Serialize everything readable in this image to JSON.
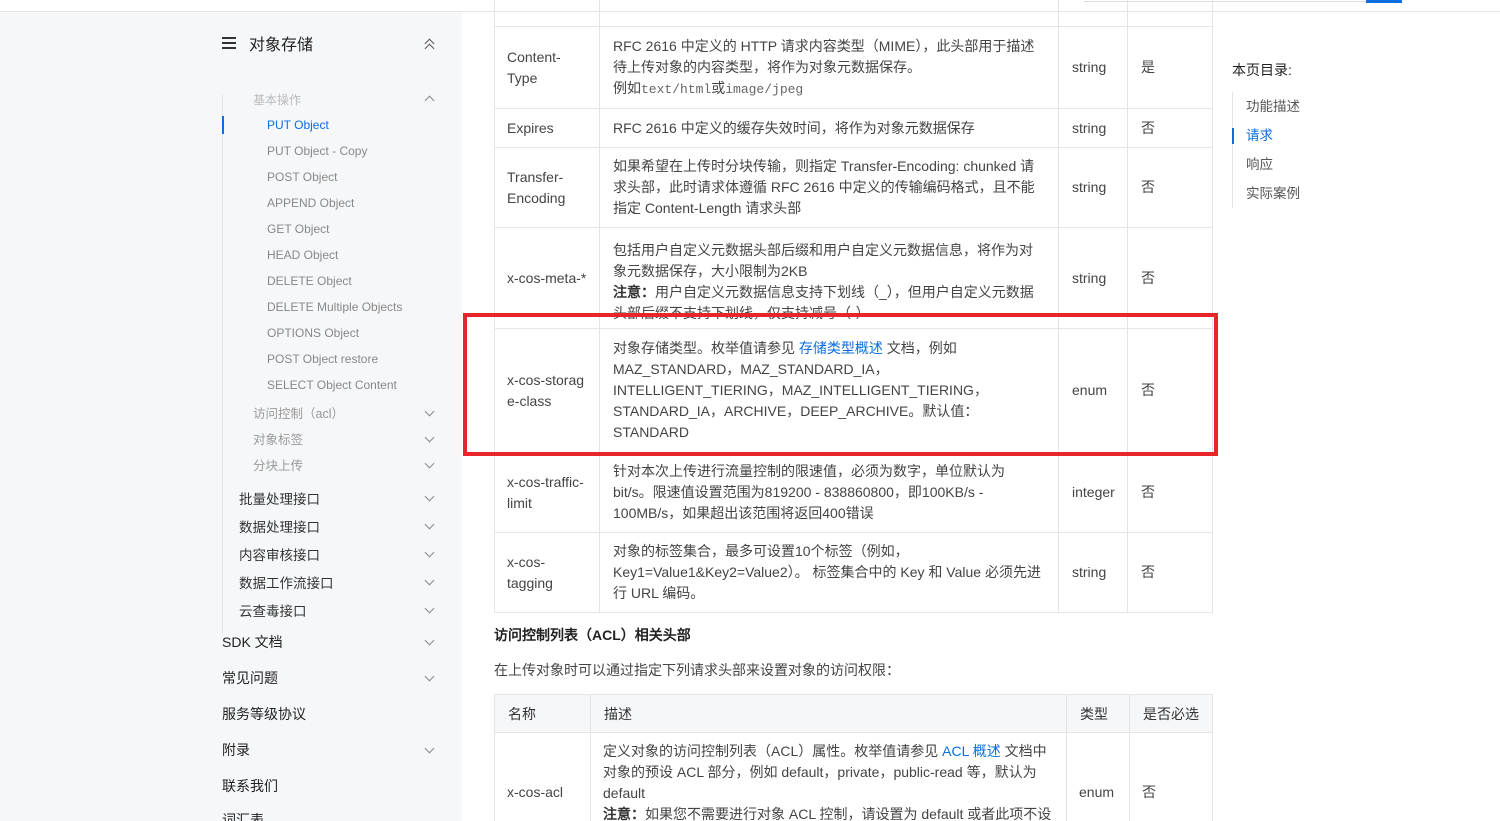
{
  "sidebar": {
    "title": "对象存储",
    "faded_item": "基本操作",
    "object_ops": [
      {
        "label": "PUT Object",
        "active": true
      },
      {
        "label": "PUT Object - Copy"
      },
      {
        "label": "POST Object"
      },
      {
        "label": "APPEND Object"
      },
      {
        "label": "GET Object"
      },
      {
        "label": "HEAD Object"
      },
      {
        "label": "DELETE Object"
      },
      {
        "label": "DELETE Multiple Objects"
      },
      {
        "label": "OPTIONS Object"
      },
      {
        "label": "POST Object restore"
      },
      {
        "label": "SELECT Object Content"
      }
    ],
    "sub_groups": [
      {
        "label": "访问控制（acl）"
      },
      {
        "label": "对象标签"
      },
      {
        "label": "分块上传"
      }
    ],
    "api_groups": [
      {
        "label": "批量处理接口"
      },
      {
        "label": "数据处理接口"
      },
      {
        "label": "内容审核接口"
      },
      {
        "label": "数据工作流接口"
      },
      {
        "label": "云查毒接口"
      }
    ],
    "top_items": [
      {
        "label": "SDK 文档",
        "expandable": true
      },
      {
        "label": "常见问题",
        "expandable": true
      },
      {
        "label": "服务等级协议",
        "expandable": false
      },
      {
        "label": "附录",
        "expandable": true
      },
      {
        "label": "联系我们",
        "expandable": false
      },
      {
        "label": "词汇表",
        "expandable": false
      }
    ]
  },
  "params_table": {
    "rows": [
      {
        "name": "Content-Type",
        "desc_line1": "RFC 2616 中定义的 HTTP 请求内容类型（MIME），此头部用于描述待上传对象的内容类型，将作为对象元数据保存。",
        "desc_example_prefix": "例如",
        "desc_code1": "text/html",
        "desc_or": "或",
        "desc_code2": "image/jpeg",
        "type": "string",
        "required": "是"
      },
      {
        "name": "Expires",
        "desc": "RFC 2616 中定义的缓存失效时间，将作为对象元数据保存",
        "type": "string",
        "required": "否"
      },
      {
        "name": "Transfer-Encoding",
        "desc": "如果希望在上传时分块传输，则指定 Transfer-Encoding: chunked 请求头部，此时请求体遵循 RFC 2616 中定义的传输编码格式，且不能指定 Content-Length 请求头部",
        "type": "string",
        "required": "否"
      },
      {
        "name": "x-cos-meta-*",
        "desc": "包括用户自定义元数据头部后缀和用户自定义元数据信息，将作为对象元数据保存，大小限制为2KB",
        "note_label": "注意：",
        "note": "用户自定义元数据信息支持下划线（_），但用户自定义元数据头部后缀不支持下划线，仅支持减号（-）",
        "type": "string",
        "required": "否"
      },
      {
        "name": "x-cos-storage-class",
        "desc_before": "对象存储类型。枚举值请参见 ",
        "desc_link": "存储类型概述",
        "desc_after": " 文档，例如 MAZ_STANDARD，MAZ_STANDARD_IA，INTELLIGENT_TIERING，MAZ_INTELLIGENT_TIERING，STANDARD_IA，ARCHIVE，DEEP_ARCHIVE。默认值：STANDARD",
        "type": "enum",
        "required": "否"
      },
      {
        "name": "x-cos-traffic-limit",
        "desc": "针对本次上传进行流量控制的限速值，必须为数字，单位默认为 bit/s。限速值设置范围为819200 - 838860800，即100KB/s - 100MB/s，如果超出该范围将返回400错误",
        "type": "integer",
        "required": "否"
      },
      {
        "name": "x-cos-tagging",
        "desc": "对象的标签集合，最多可设置10个标签（例如，Key1=Value1&Key2=Value2）。 标签集合中的 Key 和 Value 必须先进行 URL 编码。",
        "type": "string",
        "required": "否"
      }
    ]
  },
  "acl_section": {
    "title": "访问控制列表（ACL）相关头部",
    "intro": "在上传对象时可以通过指定下列请求头部来设置对象的访问权限：",
    "headers": {
      "name": "名称",
      "desc": "描述",
      "type": "类型",
      "required": "是否必选"
    },
    "row": {
      "name": "x-cos-acl",
      "desc_before": "定义对象的访问控制列表（ACL）属性。枚举值请参见 ",
      "desc_link": "ACL 概述",
      "desc_after": " 文档中对象的预设 ACL 部分，例如 default，private，public-read 等，默认为 default",
      "note_label": "注意：",
      "note": "如果您不需要进行对象 ACL 控制，请设置为 default 或者此项不设置",
      "type": "enum",
      "required": "否"
    }
  },
  "toc": {
    "title": "本页目录:",
    "items": [
      {
        "label": "功能描述"
      },
      {
        "label": "请求",
        "active": true
      },
      {
        "label": "响应"
      },
      {
        "label": "实际案例"
      }
    ]
  },
  "colors": {
    "accent": "#0a6ee1",
    "highlight": "#e8262a",
    "sidebar_bg": "#f6f7f9"
  }
}
